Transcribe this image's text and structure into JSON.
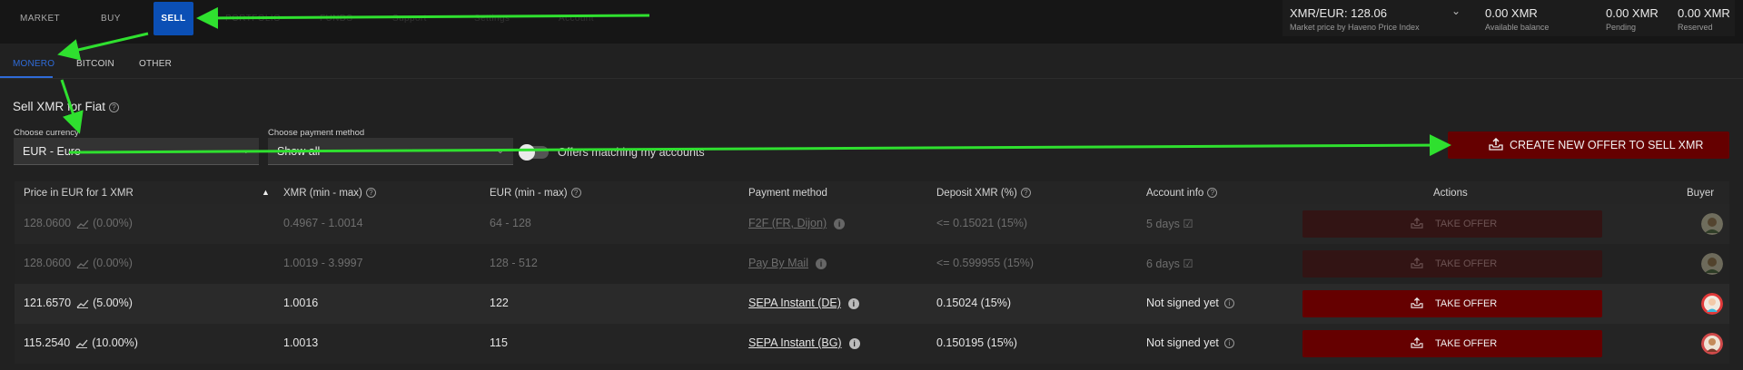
{
  "nav": {
    "items": [
      "MARKET",
      "BUY",
      "SELL",
      "PORTFOLIO",
      "FUNDS",
      "Support",
      "Settings",
      "Account"
    ],
    "active": "SELL"
  },
  "market": {
    "price_label": "XMR/EUR: 128.06",
    "price_sub": "Market price by Haveno Price Index",
    "balances": [
      {
        "value": "0.00 XMR",
        "label": "Available balance"
      },
      {
        "value": "0.00 XMR",
        "label": "Pending"
      },
      {
        "value": "0.00 XMR",
        "label": "Reserved"
      }
    ]
  },
  "subtabs": {
    "items": [
      "MONERO",
      "BITCOIN",
      "OTHER"
    ],
    "active": "MONERO"
  },
  "filters": {
    "title": "Sell XMR for Fiat",
    "currency_label": "Choose currency",
    "currency_value": "EUR  -  Euro",
    "payment_label": "Choose payment method",
    "payment_value": "Show all",
    "toggle_label": "Offers matching my accounts",
    "create_button": "CREATE NEW OFFER TO SELL XMR"
  },
  "table": {
    "columns": [
      "Price in EUR for 1 XMR",
      "XMR (min - max)",
      "EUR (min - max)",
      "Payment method",
      "Deposit XMR (%)",
      "Account info",
      "Actions",
      "Buyer"
    ],
    "rows": [
      {
        "price": "128.0600",
        "pct": "(0.00%)",
        "xmr": "0.4967 - 1.0014",
        "eur": "64 - 128",
        "method": "F2F (FR, Dijon)",
        "deposit": "<= 0.15021 (15%)",
        "account": "5 days",
        "action": "TAKE OFFER",
        "faded": true
      },
      {
        "price": "128.0600",
        "pct": "(0.00%)",
        "xmr": "1.0019 - 3.9997",
        "eur": "128 - 512",
        "method": "Pay By Mail",
        "deposit": "<= 0.599955 (15%)",
        "account": "6 days",
        "action": "TAKE OFFER",
        "faded": true
      },
      {
        "price": "121.6570",
        "pct": "(5.00%)",
        "xmr": "1.0016",
        "eur": "122",
        "method": "SEPA Instant (DE)",
        "deposit": "0.15024 (15%)",
        "account": "Not signed yet",
        "action": "TAKE OFFER",
        "faded": false
      },
      {
        "price": "115.2540",
        "pct": "(10.00%)",
        "xmr": "1.0013",
        "eur": "115",
        "method": "SEPA Instant (BG)",
        "deposit": "0.150195 (15%)",
        "account": "Not signed yet",
        "action": "TAKE OFFER",
        "faded": false
      }
    ]
  },
  "colors": {
    "accent": "#0b4fb5",
    "tab_active": "#2f6bd8",
    "action": "#650000",
    "annotation_arrow": "#2fe02f"
  }
}
